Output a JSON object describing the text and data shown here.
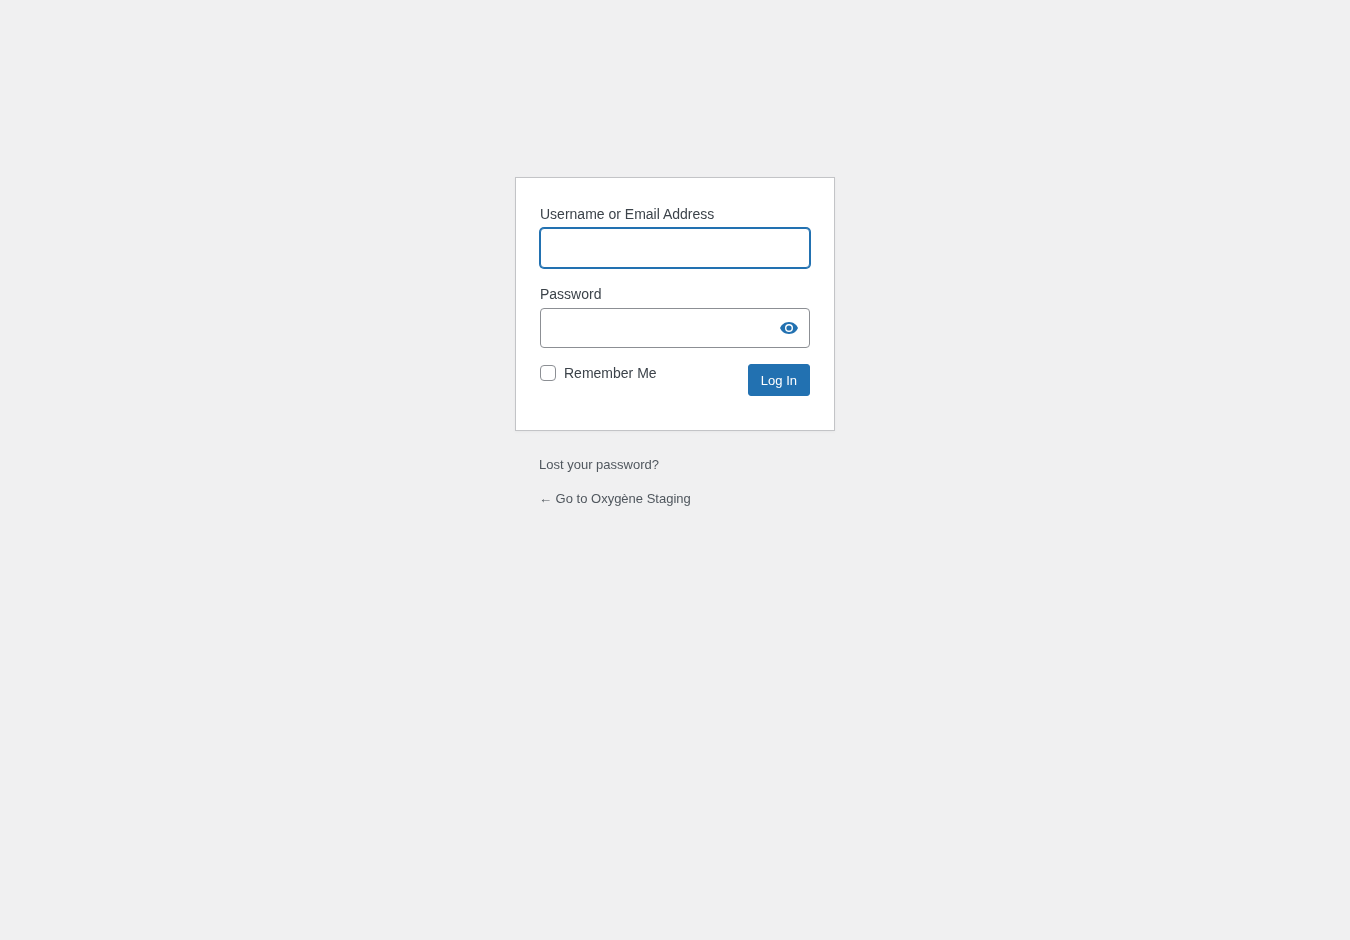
{
  "fields": [
    {
      "label": "Username or Email Address",
      "kind": "text",
      "focused": true
    },
    {
      "label": "Password",
      "kind": "password",
      "focused": false
    }
  ],
  "remember": {
    "label": "Remember Me",
    "checked": false
  },
  "submit": {
    "label": "Log In"
  },
  "links": [
    {
      "text": "Lost your password?"
    },
    {
      "text": "← Go to Oxygène Staging"
    }
  ]
}
